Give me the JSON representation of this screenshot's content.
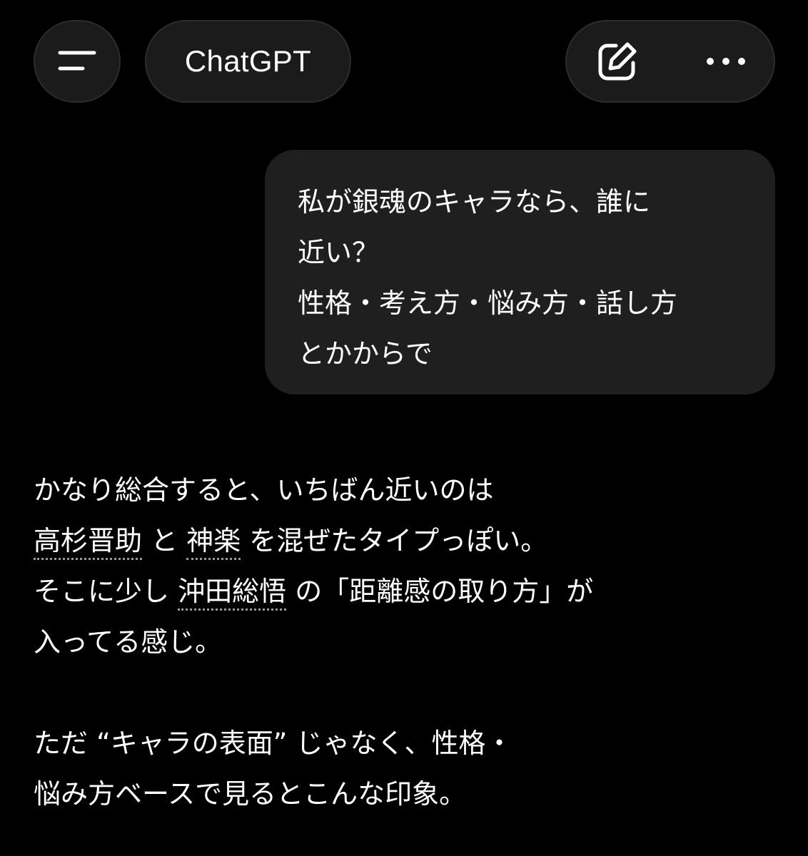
{
  "header": {
    "menu_icon": "hamburger-menu-icon",
    "title": "ChatGPT",
    "new_chat_icon": "edit-pencil-icon",
    "more_icon": "more-dots-icon"
  },
  "user_message": {
    "lines": [
      "私が銀魂のキャラなら、誰に",
      "近い？",
      "性格・考え方・悩み方・話し方",
      "とかからで"
    ]
  },
  "assistant_message": {
    "p1_line1": "かなり総合すると、いちばん近いのは",
    "link_takasugi": "高杉晋助",
    "to": " と ",
    "link_kagura": "神楽",
    "p1_line2_rest": " を混ぜたタイプっぽい。",
    "p1_line3_pre": "そこに少し ",
    "link_okita": "沖田総悟",
    "p1_line3_post": " の「距離感の取り方」が",
    "p1_line4": "入ってる感じ。",
    "p2_line1": "ただ “キャラの表面” じゃなく、性格・",
    "p2_line2": "悩み方ベースで見るとこんな印象。"
  }
}
